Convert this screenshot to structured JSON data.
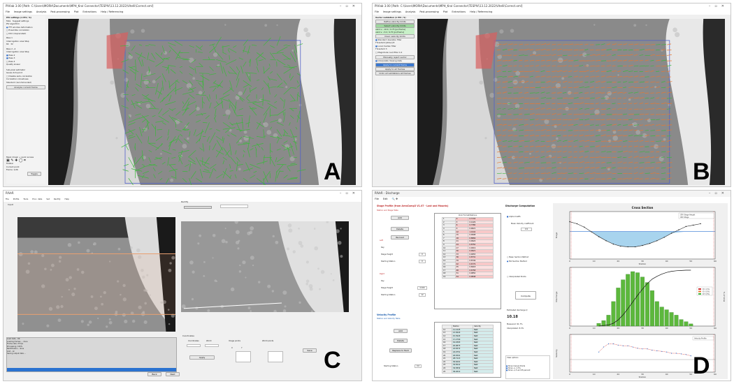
{
  "panelA": {
    "label": "A",
    "title": "PIVlab 3.00 [Path: C:\\Users\\MORH\\Documents\\MPH_Kral Connector\\TESPIV\\13.12.2022\\Vitelli\\Correct.xml]",
    "menu": [
      "File",
      "Image settings",
      "Analysis",
      "Post-processing",
      "Plot",
      "Extractions",
      "Help / Referencing"
    ],
    "settings": [
      "PIV settings (1 PIV / S)",
      "Tabs",
      "Suggest settings",
      "PIV algorithm",
      "FFT window deformation",
      "Ensemble correlation",
      "DCC (deprecated)",
      "Pass 1",
      "Interrogation area",
      "Step",
      "64",
      "32",
      "Pass 2...4",
      "Interrogation area",
      "Step",
      "Pass 2",
      "Pass 3",
      "Pass 4",
      "Quality  slower",
      "Sub-pixel estimator",
      "Gauss 2x3-point",
      "Disable auto-correlation",
      "Correlation robustness",
      "Standard (recommended)",
      "Analyze current frame"
    ],
    "mask_tools": [
      "Mask (draw) + quick access",
      "Toolbar",
      "Current point",
      "Frame: 1/26",
      "Toggle"
    ]
  },
  "panelB": {
    "label": "B",
    "title": "PIVlab 3.00 [Path: C:\\Users\\MORH\\Documents\\MPH_Kral Connector\\TESPIV\\13.12.2022\\Vitelli\\Correct.xml]",
    "menu": [
      "File",
      "Image settings",
      "Analysis",
      "Post-processing",
      "Plot",
      "Extractions",
      "Help / Referencing"
    ],
    "validation": [
      "Vector validation (1 PIV / S)",
      "Refine velocity limits",
      "Select velocity limits",
      "valid u: -10.0 / 9.75 [px/frame]",
      "valid v: -3.0 / 9.75 [px/frame]",
      "Clear velocity limits",
      "Standard deviation filter",
      "Threshold [stdev]",
      "8",
      "Local median filter",
      "Threshold",
      "3",
      "Magnitude (vel) filter",
      "1.0",
      "Manually reject vector",
      "Interpolate missing data",
      "Apply to current frame",
      "Apply to all frames",
      "Undo all validations all frames"
    ]
  },
  "panelC": {
    "label": "C",
    "title": "RIVeR",
    "menu": [
      "File",
      "Profile",
      "Tools",
      "Proc. data",
      "Set",
      "Rectify",
      "Help"
    ],
    "left_header": "Input",
    "right_header": "Rectify",
    "log": [
      "Load data - OK",
      "Loading frames ... done",
      "Frame rate: 25 fps",
      "Processing: 100%",
      "Rectification - done",
      "Grid - ok",
      "Saving output data ..."
    ],
    "bottom_header": "Coordinates",
    "bottom_labels": [
      "Coordinates",
      "World",
      "Image points",
      "World points",
      "X",
      "Y",
      "Apply",
      "Save"
    ],
    "buttons": [
      "Back",
      "Next"
    ]
  },
  "panelD": {
    "label": "D",
    "title": "RIVeR - Discharge",
    "menu": [
      "File",
      "Edit"
    ],
    "stage_title": "Stage Profile (from AreaComp3 V1.07 - Lost and Mounts)",
    "station_header": "Station and Stage Table",
    "buttons": [
      "Add",
      "Delete",
      "Re-load",
      "Compute"
    ],
    "fields": [
      "Left",
      "Key",
      "Stage Height",
      "Starting Station",
      "Right",
      "Key",
      "Stage Height",
      "Starting Station"
    ],
    "field_values": [
      "0",
      "0",
      "4.044",
      "12"
    ],
    "table_headers": [
      "Station",
      "Stage"
    ],
    "table_rows": [
      [
        "1",
        "0",
        "0.7134"
      ],
      [
        "2",
        "3",
        "0.1429"
      ],
      [
        "3",
        "6",
        "0.7380"
      ],
      [
        "4",
        "9",
        "0.9621"
      ],
      [
        "5",
        "12",
        "1.0142"
      ],
      [
        "6",
        "15",
        "0.9998"
      ],
      [
        "7",
        "18",
        "0.8869"
      ],
      [
        "8",
        "21",
        "0.9924"
      ],
      [
        "9",
        "24",
        "0.8750"
      ],
      [
        "10",
        "27",
        "0.9919"
      ],
      [
        "11",
        "30",
        "0.9921"
      ],
      [
        "12",
        "33",
        "0.9955"
      ],
      [
        "13",
        "36",
        "0.8731"
      ],
      [
        "14",
        "39",
        "0.8749"
      ],
      [
        "15",
        "42",
        "0.6779"
      ],
      [
        "16",
        "45",
        "0.6918"
      ],
      [
        "17",
        "48",
        "0.6758"
      ],
      [
        "18",
        "51",
        "0.9850"
      ],
      [
        "19",
        "54",
        "0.9848"
      ]
    ],
    "velocity_title": "Velocity Profile",
    "velocity_header": "Station and Velocity Table",
    "velocity_cols": [
      "Station",
      "Velocity"
    ],
    "velocity_rows": [
      [
        "12",
        "11.1225",
        "NaN"
      ],
      [
        "13",
        "13.3643",
        "NaN"
      ],
      [
        "14",
        "15.3943",
        "NaN"
      ],
      [
        "15",
        "17.2790",
        "NaN"
      ],
      [
        "16",
        "19.0393",
        "NaN"
      ],
      [
        "17",
        "20.9873",
        "NaN"
      ],
      [
        "18",
        "22.8372",
        "NaN"
      ],
      [
        "19",
        "24.9751",
        "NaN"
      ],
      [
        "20",
        "26.8301",
        "NaN"
      ],
      [
        "21",
        "28.7113",
        "NaN"
      ],
      [
        "22",
        "30.6201",
        "NaN"
      ],
      [
        "23",
        "32.5012",
        "NaN"
      ],
      [
        "24",
        "34.3832",
        "NaN"
      ],
      [
        "25",
        "36.2612",
        "NaN"
      ]
    ],
    "velocity_buttons": [
      "Add",
      "Delete",
      "Replace to field"
    ],
    "velocity_station_label": "Starting Station",
    "velocity_station_value": "0.0",
    "discharge_title": "Discharge Computation",
    "discharge": [
      "Alpha Coeffs",
      "Mean Velocity coefficient",
      "0.9",
      "Mean Section Method",
      "Mid Section Method",
      "Interpolated Points",
      "Compute",
      "Estimated discharge Q",
      "10.18",
      "Measured: 91.7%",
      "Interpolated: 8.3%",
      "View options",
      "Show manual Points",
      "Show +/- 2.5%",
      "Show +/-5 and 95 percent"
    ],
    "chart_titles": [
      "Cross Section",
      "Velocity Profile"
    ],
    "chart_axes": [
      "Stage",
      "Station",
      "Discharge",
      "% of total",
      "Velocity",
      "Station"
    ],
    "chart_legends": [
      "Cross Section",
      "CRV Stage Height",
      "CRV Stage",
      "ID 1 (1%)",
      "ID 3 (3%)",
      "ID 5 (5%)",
      "Velocity Profile"
    ]
  },
  "chart_data": [
    {
      "type": "area",
      "title": "Cross Section",
      "x": [
        0,
        3,
        6,
        9,
        12,
        15,
        18,
        21,
        24,
        27,
        30,
        33,
        36,
        39,
        42,
        45,
        48,
        51,
        54
      ],
      "values": [
        5.5,
        5.2,
        4.7,
        4.0,
        3.3,
        2.7,
        2.2,
        1.9,
        1.8,
        1.8,
        2.0,
        2.3,
        2.7,
        3.2,
        3.8,
        4.3,
        4.8,
        5.0,
        5.2
      ],
      "water_level": 4.05,
      "xlim": [
        0,
        60
      ],
      "ylim": [
        0,
        7
      ]
    },
    {
      "type": "bar",
      "x": [
        12,
        14,
        16,
        18,
        20,
        22,
        24,
        26,
        28,
        30,
        32,
        34,
        36,
        38,
        40,
        42,
        44,
        46,
        48,
        50
      ],
      "values": [
        0.05,
        0.1,
        0.2,
        0.45,
        0.7,
        0.85,
        0.95,
        1.0,
        0.98,
        0.9,
        0.8,
        0.65,
        0.45,
        0.35,
        0.3,
        0.25,
        0.2,
        0.12,
        0.08,
        0.04
      ],
      "cumulative": [
        0,
        1,
        2,
        5,
        11,
        20,
        31,
        43,
        55,
        66,
        76,
        84,
        89,
        93,
        96,
        98,
        99,
        99.5,
        100,
        100
      ],
      "xlim": [
        0,
        60
      ]
    },
    {
      "type": "line",
      "title": "Velocity Profile",
      "x": [
        12,
        14,
        16,
        18,
        20,
        22,
        24,
        26,
        28,
        30,
        32,
        34,
        36,
        38,
        40,
        42,
        44,
        46,
        48,
        50
      ],
      "values": [
        0.12,
        0.2,
        0.25,
        0.25,
        0.23,
        0.22,
        0.22,
        0.2,
        0.18,
        0.17,
        0.17,
        0.15,
        0.14,
        0.13,
        0.12,
        0.1,
        0.1,
        0.09,
        0.08,
        0.06
      ],
      "xlim": [
        0,
        60
      ]
    }
  ]
}
